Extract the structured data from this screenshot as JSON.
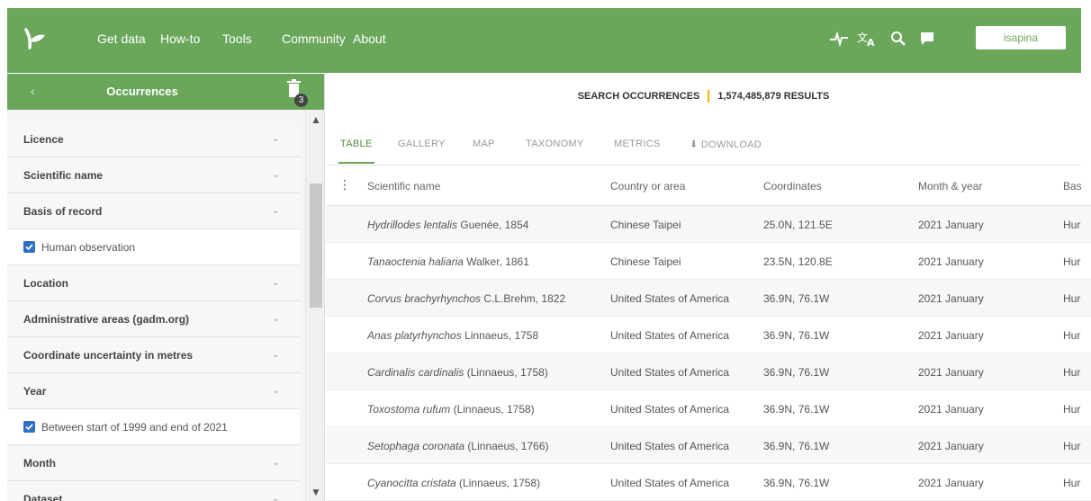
{
  "nav": {
    "items": [
      "Get data",
      "How-to",
      "Tools",
      "Community",
      "About"
    ],
    "user": "isapina",
    "icons": [
      "pulse-icon",
      "translate-icon",
      "search-icon",
      "chat-icon"
    ],
    "accent": "#6aa75b"
  },
  "sidebar": {
    "back": "‹",
    "title": "Occurrences",
    "badge": "3",
    "filters": [
      {
        "label": "Licence",
        "type": "section"
      },
      {
        "label": "Scientific name",
        "type": "section"
      },
      {
        "label": "Basis of record",
        "type": "section"
      },
      {
        "label": "Human observation",
        "type": "option"
      },
      {
        "label": "Location",
        "type": "section"
      },
      {
        "label": "Administrative areas (gadm.org)",
        "type": "section"
      },
      {
        "label": "Coordinate uncertainty in metres",
        "type": "section"
      },
      {
        "label": "Year",
        "type": "section"
      },
      {
        "label": "Between start of 1999 and end of 2021",
        "type": "option"
      },
      {
        "label": "Month",
        "type": "section"
      },
      {
        "label": "Dataset",
        "type": "section"
      }
    ]
  },
  "summary": {
    "label": "SEARCH OCCURRENCES",
    "count": "1,574,485,879 RESULTS"
  },
  "tabs": [
    "TABLE",
    "GALLERY",
    "MAP",
    "TAXONOMY",
    "METRICS",
    "⬇ DOWNLOAD"
  ],
  "table": {
    "columns": [
      "Scientific name",
      "Country or area",
      "Coordinates",
      "Month & year",
      "Bas"
    ],
    "rows": [
      {
        "name": "Hydrillodes lentalis",
        "author": " Guenée, 1854",
        "country": "Chinese Taipei",
        "coords": "25.0N, 121.5E",
        "date": "2021 January",
        "basis": "Hur"
      },
      {
        "name": "Tanaoctenia haliaria",
        "author": " Walker, 1861",
        "country": "Chinese Taipei",
        "coords": "23.5N, 120.8E",
        "date": "2021 January",
        "basis": "Hur"
      },
      {
        "name": "Corvus brachyrhynchos",
        "author": " C.L.Brehm, 1822",
        "country": "United States of America",
        "coords": "36.9N, 76.1W",
        "date": "2021 January",
        "basis": "Hur"
      },
      {
        "name": "Anas platyrhynchos",
        "author": " Linnaeus, 1758",
        "country": "United States of America",
        "coords": "36.9N, 76.1W",
        "date": "2021 January",
        "basis": "Hur"
      },
      {
        "name": "Cardinalis cardinalis",
        "author": " (Linnaeus, 1758)",
        "country": "United States of America",
        "coords": "36.9N, 76.1W",
        "date": "2021 January",
        "basis": "Hur"
      },
      {
        "name": "Toxostoma rufum",
        "author": " (Linnaeus, 1758)",
        "country": "United States of America",
        "coords": "36.9N, 76.1W",
        "date": "2021 January",
        "basis": "Hur"
      },
      {
        "name": "Setophaga coronata",
        "author": " (Linnaeus, 1766)",
        "country": "United States of America",
        "coords": "36.9N, 76.1W",
        "date": "2021 January",
        "basis": "Hur"
      },
      {
        "name": "Cyanocitta cristata",
        "author": " (Linnaeus, 1758)",
        "country": "United States of America",
        "coords": "36.9N, 76.1W",
        "date": "2021 January",
        "basis": "Hur"
      }
    ]
  }
}
